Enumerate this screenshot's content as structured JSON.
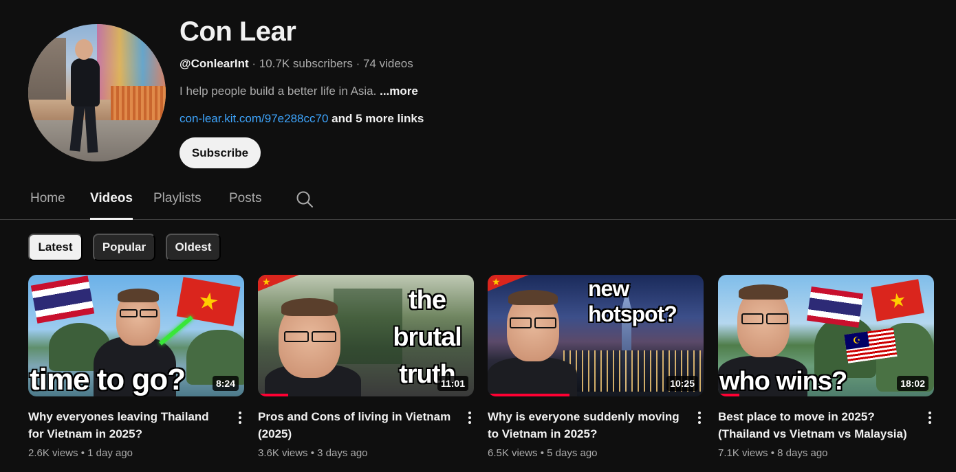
{
  "channel": {
    "name": "Con Lear",
    "handle": "@ConlearInt",
    "subscribers": "10.7K subscribers",
    "video_count": "74 videos",
    "description": "I help people build a better life in Asia.",
    "more_label": "...more",
    "link": "con-lear.kit.com/97e288cc70",
    "more_links": "and 5 more links",
    "subscribe_label": "Subscribe"
  },
  "tabs": [
    {
      "label": "Home",
      "active": false
    },
    {
      "label": "Videos",
      "active": true
    },
    {
      "label": "Playlists",
      "active": false
    },
    {
      "label": "Posts",
      "active": false
    }
  ],
  "filters": [
    {
      "label": "Latest",
      "active": true
    },
    {
      "label": "Popular",
      "active": false
    },
    {
      "label": "Oldest",
      "active": false
    }
  ],
  "videos": [
    {
      "title": "Why everyones leaving Thailand for Vietnam in 2025?",
      "views": "2.6K views",
      "age": "1 day ago",
      "duration": "8:24",
      "overlay_text": "time to go?",
      "watched_fraction": 0
    },
    {
      "title": "Pros and Cons of living in Vietnam (2025)",
      "views": "3.6K views",
      "age": "3 days ago",
      "duration": "11:01",
      "overlay_text": [
        "the",
        "brutal",
        "truth"
      ],
      "watched_fraction": 0.14
    },
    {
      "title": "Why is everyone suddenly moving to Vietnam in 2025?",
      "views": "6.5K views",
      "age": "5 days ago",
      "duration": "10:25",
      "overlay_text": "new hotspot?",
      "watched_fraction": 0.38
    },
    {
      "title": "Best place to move in 2025? (Thailand vs Vietnam vs Malaysia)",
      "views": "7.1K views",
      "age": "8 days ago",
      "duration": "18:02",
      "overlay_text": "who wins?",
      "watched_fraction": 0.1
    }
  ],
  "colors": {
    "background": "#0f0f0f",
    "link": "#3ea6ff",
    "progress": "#ff0033",
    "chip": "#272727"
  }
}
